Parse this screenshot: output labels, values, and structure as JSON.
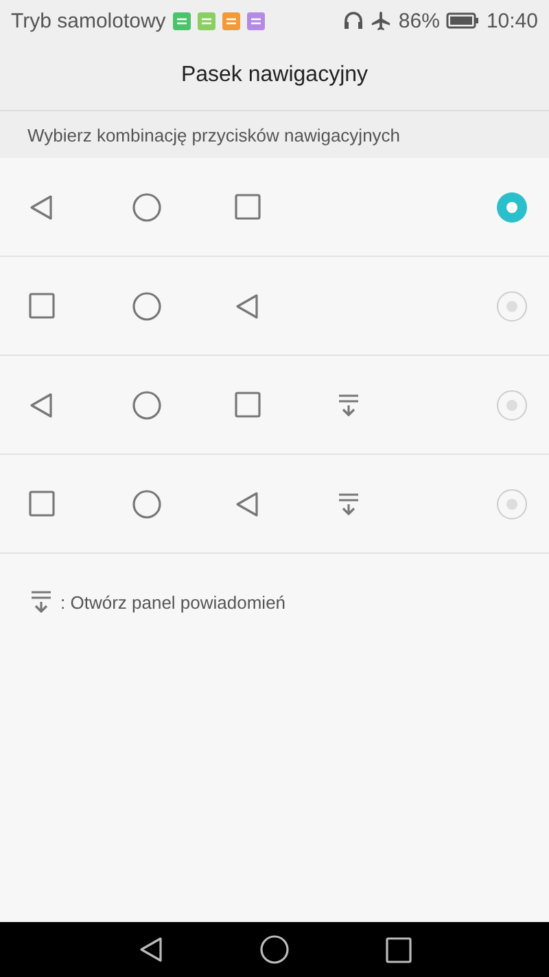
{
  "status_bar": {
    "carrier": "Tryb samolotowy",
    "battery": "86%",
    "time": "10:40"
  },
  "title": "Pasek nawigacyjny",
  "section_header": "Wybierz kombinację przycisków nawigacyjnych",
  "options": [
    {
      "buttons": [
        {
          "kind": "back"
        },
        {
          "kind": "home"
        },
        {
          "kind": "recent"
        }
      ],
      "selected": true
    },
    {
      "buttons": [
        {
          "kind": "recent"
        },
        {
          "kind": "home"
        },
        {
          "kind": "back"
        }
      ],
      "selected": false
    },
    {
      "buttons": [
        {
          "kind": "back"
        },
        {
          "kind": "home"
        },
        {
          "kind": "recent"
        },
        {
          "kind": "notify"
        }
      ],
      "selected": false
    },
    {
      "buttons": [
        {
          "kind": "recent"
        },
        {
          "kind": "home"
        },
        {
          "kind": "back"
        },
        {
          "kind": "notify"
        }
      ],
      "selected": false
    }
  ],
  "note": ": Otwórz panel powiadomień",
  "nav_bar": [
    {
      "kind": "back"
    },
    {
      "kind": "home"
    },
    {
      "kind": "recent"
    }
  ]
}
